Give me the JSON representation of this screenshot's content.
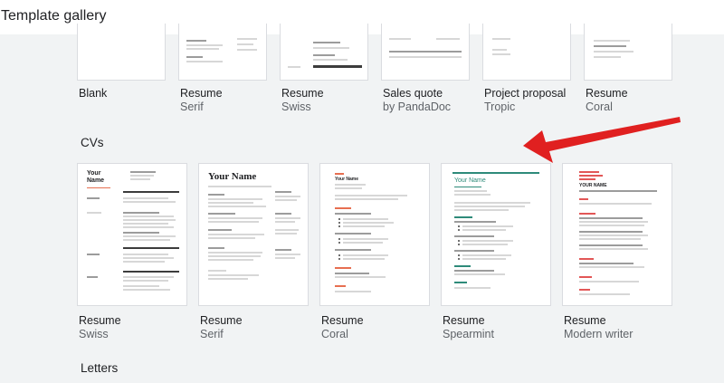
{
  "header": {
    "title": "Template gallery"
  },
  "top_row": [
    {
      "name": "Blank",
      "sub": ""
    },
    {
      "name": "Resume",
      "sub": "Serif"
    },
    {
      "name": "Resume",
      "sub": "Swiss"
    },
    {
      "name": "Sales quote",
      "sub": "by PandaDoc"
    },
    {
      "name": "Project proposal",
      "sub": "Tropic"
    },
    {
      "name": "Resume",
      "sub": "Coral"
    }
  ],
  "cvs": {
    "heading": "CVs",
    "templates": [
      {
        "name": "Resume",
        "sub": "Swiss",
        "preview_name": "Your Name"
      },
      {
        "name": "Resume",
        "sub": "Serif",
        "preview_name": "Your Name"
      },
      {
        "name": "Resume",
        "sub": "Coral",
        "preview_name": "Your Name"
      },
      {
        "name": "Resume",
        "sub": "Spearmint",
        "preview_name": "Your Name"
      },
      {
        "name": "Resume",
        "sub": "Modern writer",
        "preview_name": "YOUR NAME"
      }
    ]
  },
  "letters": {
    "heading": "Letters"
  },
  "colors": {
    "background": "#f1f3f4",
    "arrow": "#e02020",
    "coral": "#e76f51",
    "spearmint": "#2e8b7a"
  }
}
